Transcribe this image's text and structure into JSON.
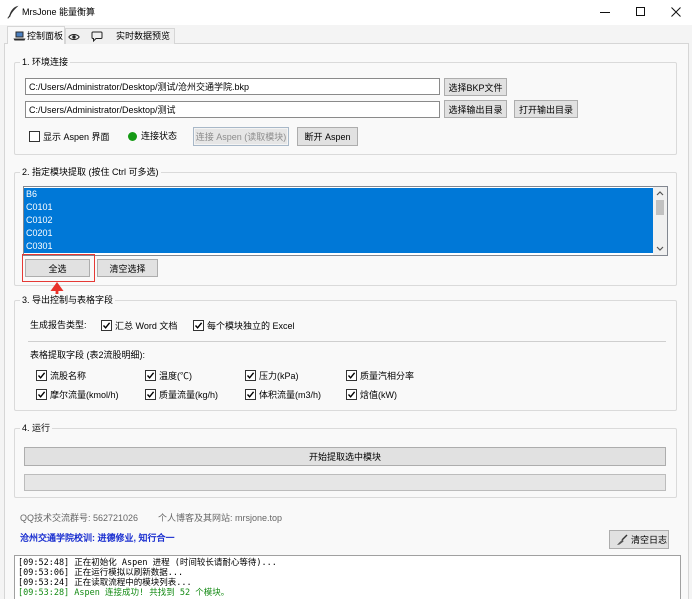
{
  "window": {
    "title": "MrsJone 能量衡算"
  },
  "tabs": [
    {
      "label": "控制面板",
      "icon": "laptop-icon",
      "selected": true
    },
    {
      "label": "实时数据预览",
      "icon": "eye-in-speech-bubble-icon",
      "selected": false
    }
  ],
  "env": {
    "title": "1. 环境连接",
    "bkp_path": "C:/Users/Administrator/Desktop/测试/沧州交通学院.bkp",
    "select_bkp_label": "选择BKP文件",
    "output_dir": "C:/Users/Administrator/Desktop/测试",
    "select_output_label": "选择输出目录",
    "open_output_label": "打开输出目录",
    "show_aspen": {
      "label": "显示 Aspen 界面",
      "checked": false
    },
    "status_label": "连接状态",
    "status_color": "#159a15",
    "connect_label": "连接 Aspen (读取模块)",
    "connect_enabled": false,
    "disconnect_label": "断开 Aspen"
  },
  "modules": {
    "title": "2. 指定模块提取 (按住 Ctrl 可多选)",
    "items": [
      "B6",
      "C0101",
      "C0102",
      "C0201",
      "C0301"
    ],
    "all_selected": true,
    "selection_color": "#0078d7",
    "select_all_label": "全选",
    "clear_selection_label": "清空选择"
  },
  "export": {
    "title": "3. 导出控制与表格字段",
    "report_type_label": "生成报告类型:",
    "reports": [
      {
        "label": "汇总 Word 文档",
        "checked": true
      },
      {
        "label": "每个模块独立的 Excel",
        "checked": true
      }
    ],
    "fields_label": "表格提取字段 (表2流股明细):",
    "fields": [
      {
        "label": "流股名称",
        "checked": true
      },
      {
        "label": "温度(℃)",
        "checked": true
      },
      {
        "label": "压力(kPa)",
        "checked": true
      },
      {
        "label": "质量汽相分率",
        "checked": true
      },
      {
        "label": "摩尔流量(kmol/h)",
        "checked": true
      },
      {
        "label": "质量流量(kg/h)",
        "checked": true
      },
      {
        "label": "体积流量(m3/h)",
        "checked": true
      },
      {
        "label": "焓值(kW)",
        "checked": true
      }
    ]
  },
  "run": {
    "title": "4. 运行",
    "start_label": "开始提取选中模块",
    "progress_percent": 0
  },
  "footer": {
    "qq": "QQ技术交流群号: 562721026",
    "blog": "个人博客及其网站: mrsjone.top",
    "motto": "沧州交通学院校训: 进德修业, 知行合一",
    "motto_color": "#1a2fd0",
    "clear_log_label": "清空日志"
  },
  "log": [
    {
      "text": "[09:52:48] 正在初始化 Aspen 进程 (时间较长请耐心等待)...",
      "color": "#000000"
    },
    {
      "text": "[09:53:06] 正在运行模拟以刷新数据...",
      "color": "#000000"
    },
    {
      "text": "[09:53:24] 正在读取流程中的模块列表...",
      "color": "#000000"
    },
    {
      "text": "[09:53:28] Aspen 连接成功! 共找到 52 个模块。",
      "color": "#138a13"
    }
  ]
}
